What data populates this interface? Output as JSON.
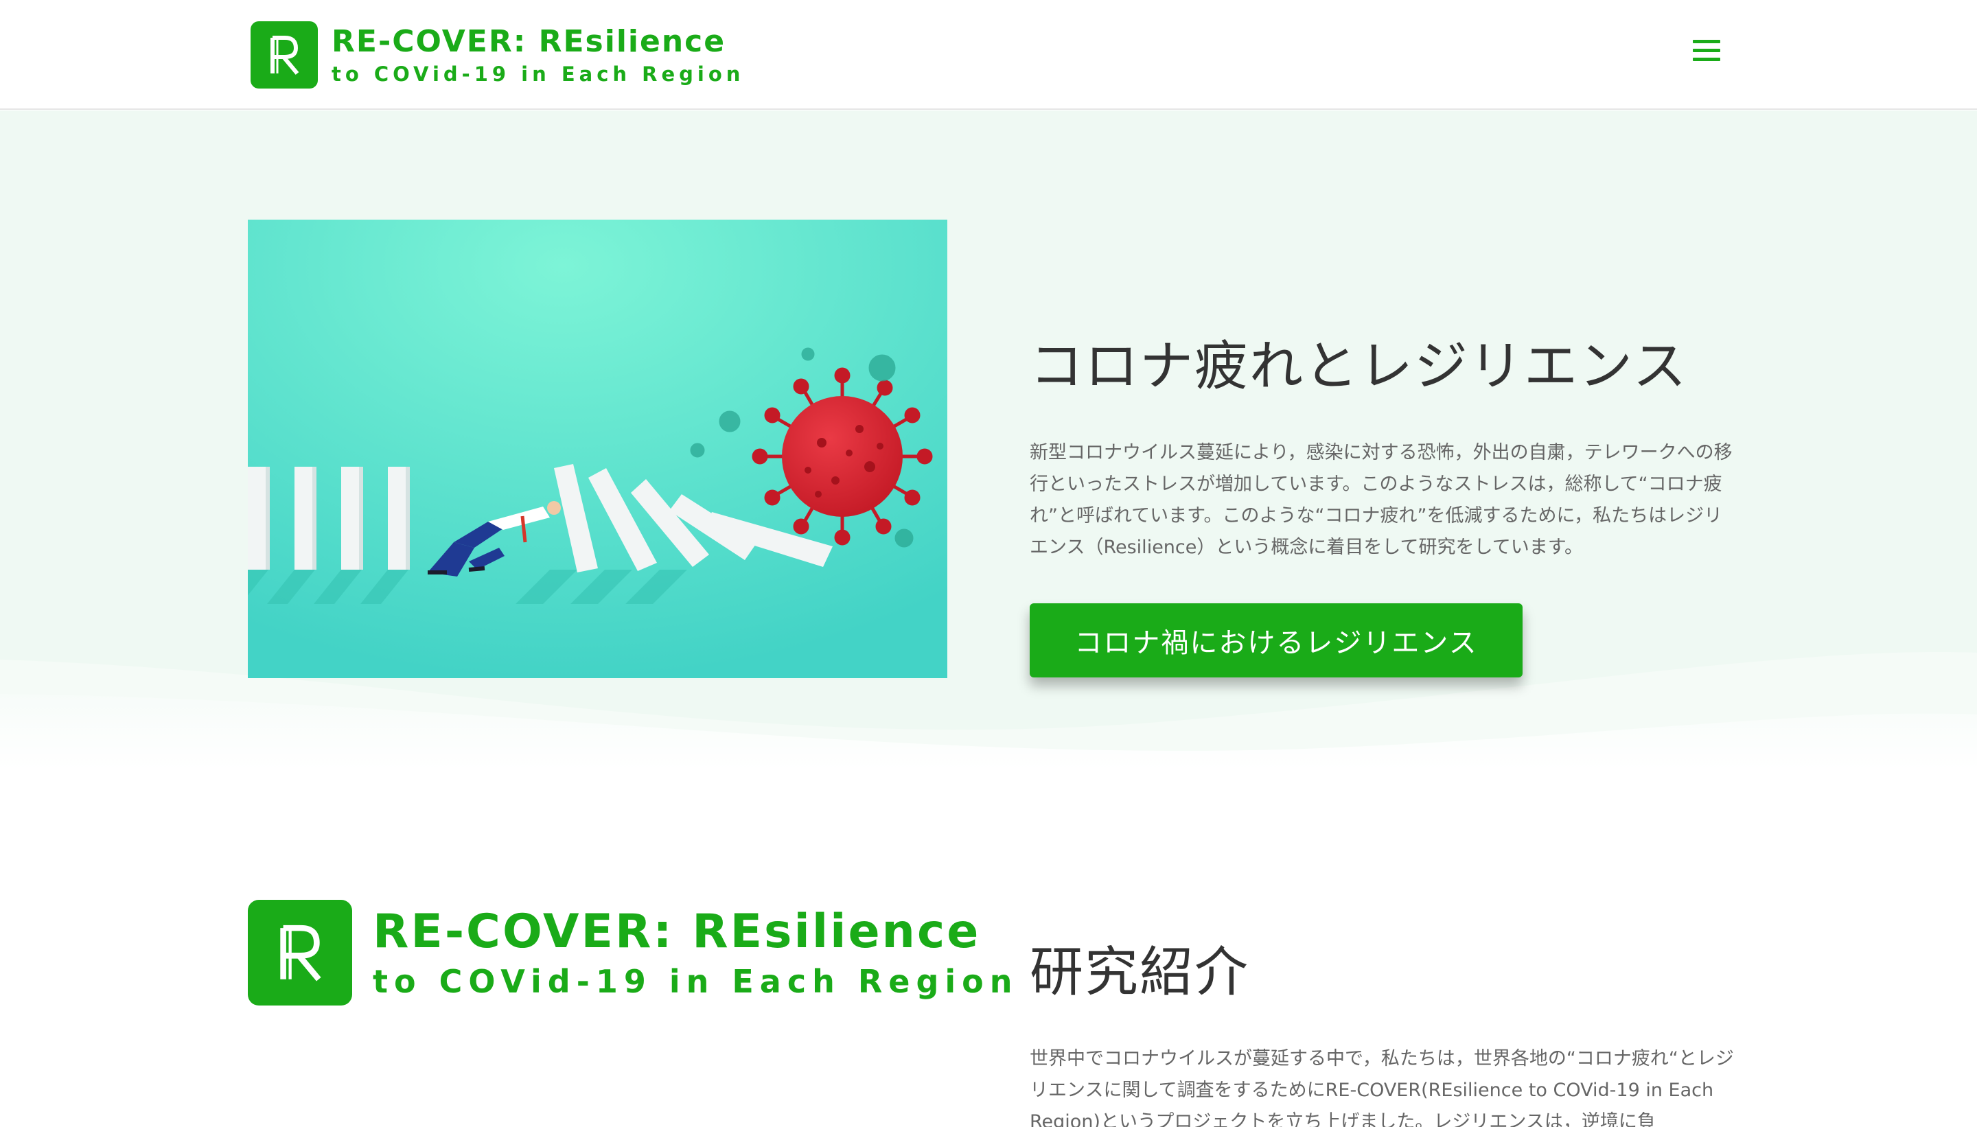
{
  "header": {
    "brand_letter": "R",
    "brand_title": "RE-COVER: REsilience",
    "brand_subtitle": "to COVid-19 in Each Region",
    "menu_icon": "hamburger-menu-icon"
  },
  "hero": {
    "title": "コロナ疲れとレジリエンス",
    "body": "新型コロナウイルス蔓延により，感染に対する恐怖，外出の自粛，テレワークへの移行といったストレスが増加しています。このようなストレスは，総称して“コロナ疲れ”と呼ばれています。このような“コロナ疲れ”を低減するために，私たちはレジリエンス（Resilience）という概念に着目をして研究をしています。",
    "button_label": "コロナ禍におけるレジリエンス",
    "image_icon": "domino-virus-illustration"
  },
  "research": {
    "logo_letter": "R",
    "logo_title": "RE-COVER: REsilience",
    "logo_subtitle": "to COVid-19 in Each Region",
    "title": "研究紹介",
    "body": "世界中でコロナウイルスが蔓延する中で，私たちは，世界各地の“コロナ疲れ“とレジリエンスに関して調査をするためにRE-COVER(REsilience to COVid-19 in Each Region)というプロジェクトを立ち上げました。レジリエンスは，逆境に負"
  },
  "colors": {
    "brand_green": "#1aab18",
    "hero_bg": "#eff9f3",
    "text_dark": "#333333",
    "text_body": "#666666",
    "virus_red": "#d11f2c",
    "illustration_bg": "#5fe0cc"
  }
}
